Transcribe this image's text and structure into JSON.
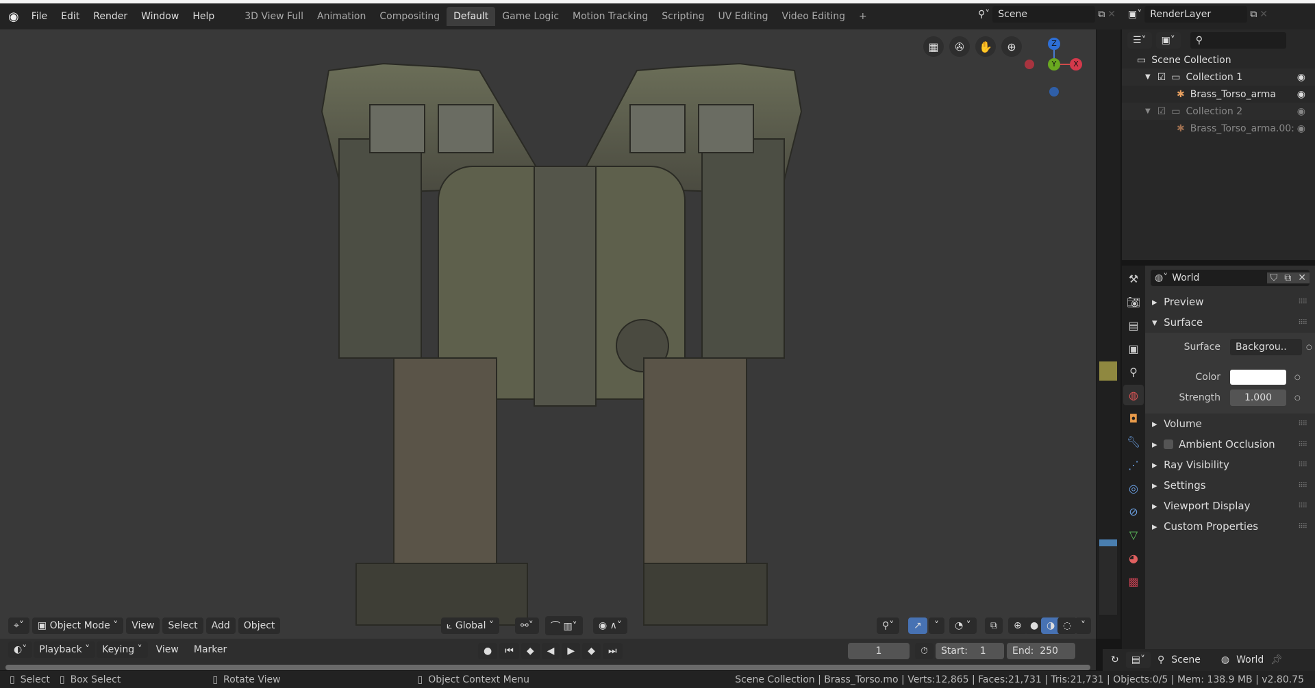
{
  "topbar": {
    "menus": [
      "File",
      "Edit",
      "Render",
      "Window",
      "Help"
    ],
    "workspaces": [
      "3D View Full",
      "Animation",
      "Compositing",
      "Default",
      "Game Logic",
      "Motion Tracking",
      "Scripting",
      "UV Editing",
      "Video Editing"
    ],
    "active_workspace": "Default",
    "add_label": "+",
    "scene": "Scene",
    "view_layer": "RenderLayer"
  },
  "viewport": {
    "header": {
      "mode": "Object Mode",
      "menus": [
        "View",
        "Select",
        "Add",
        "Object"
      ],
      "orientation": "Global"
    },
    "gizmo": {
      "z": "Z",
      "y": "Y",
      "x": "X"
    }
  },
  "timeline": {
    "menus": [
      "Playback",
      "Keying",
      "View",
      "Marker"
    ],
    "current_frame": "1",
    "start_label": "Start:",
    "start": "1",
    "end_label": "End:",
    "end": "250"
  },
  "status": {
    "select": "Select",
    "box_select": "Box Select",
    "rotate": "Rotate View",
    "context": "Object Context Menu",
    "info": "Scene Collection | Brass_Torso.mo | Verts:12,865 | Faces:21,731 | Tris:21,731 | Objects:0/5 | Mem: 138.9 MB | v2.80.75"
  },
  "outliner": {
    "root": "Scene Collection",
    "items": [
      {
        "label": "Collection 1",
        "type": "collection"
      },
      {
        "label": "Brass_Torso_arma",
        "type": "armature"
      },
      {
        "label": "Collection 2",
        "type": "collection"
      },
      {
        "label": "Brass_Torso_arma.00:",
        "type": "armature"
      }
    ]
  },
  "properties": {
    "world_name": "World",
    "panels": {
      "preview": "Preview",
      "surface": "Surface",
      "volume": "Volume",
      "ao": "Ambient Occlusion",
      "ray": "Ray Visibility",
      "settings": "Settings",
      "viewport_display": "Viewport Display",
      "custom": "Custom Properties"
    },
    "surface_label": "Surface",
    "surface_value": "Backgrou..",
    "color_label": "Color",
    "color_value": "#ffffff",
    "strength_label": "Strength",
    "strength_value": "1.000"
  },
  "bottom_right": {
    "scene": "Scene",
    "world": "World"
  }
}
